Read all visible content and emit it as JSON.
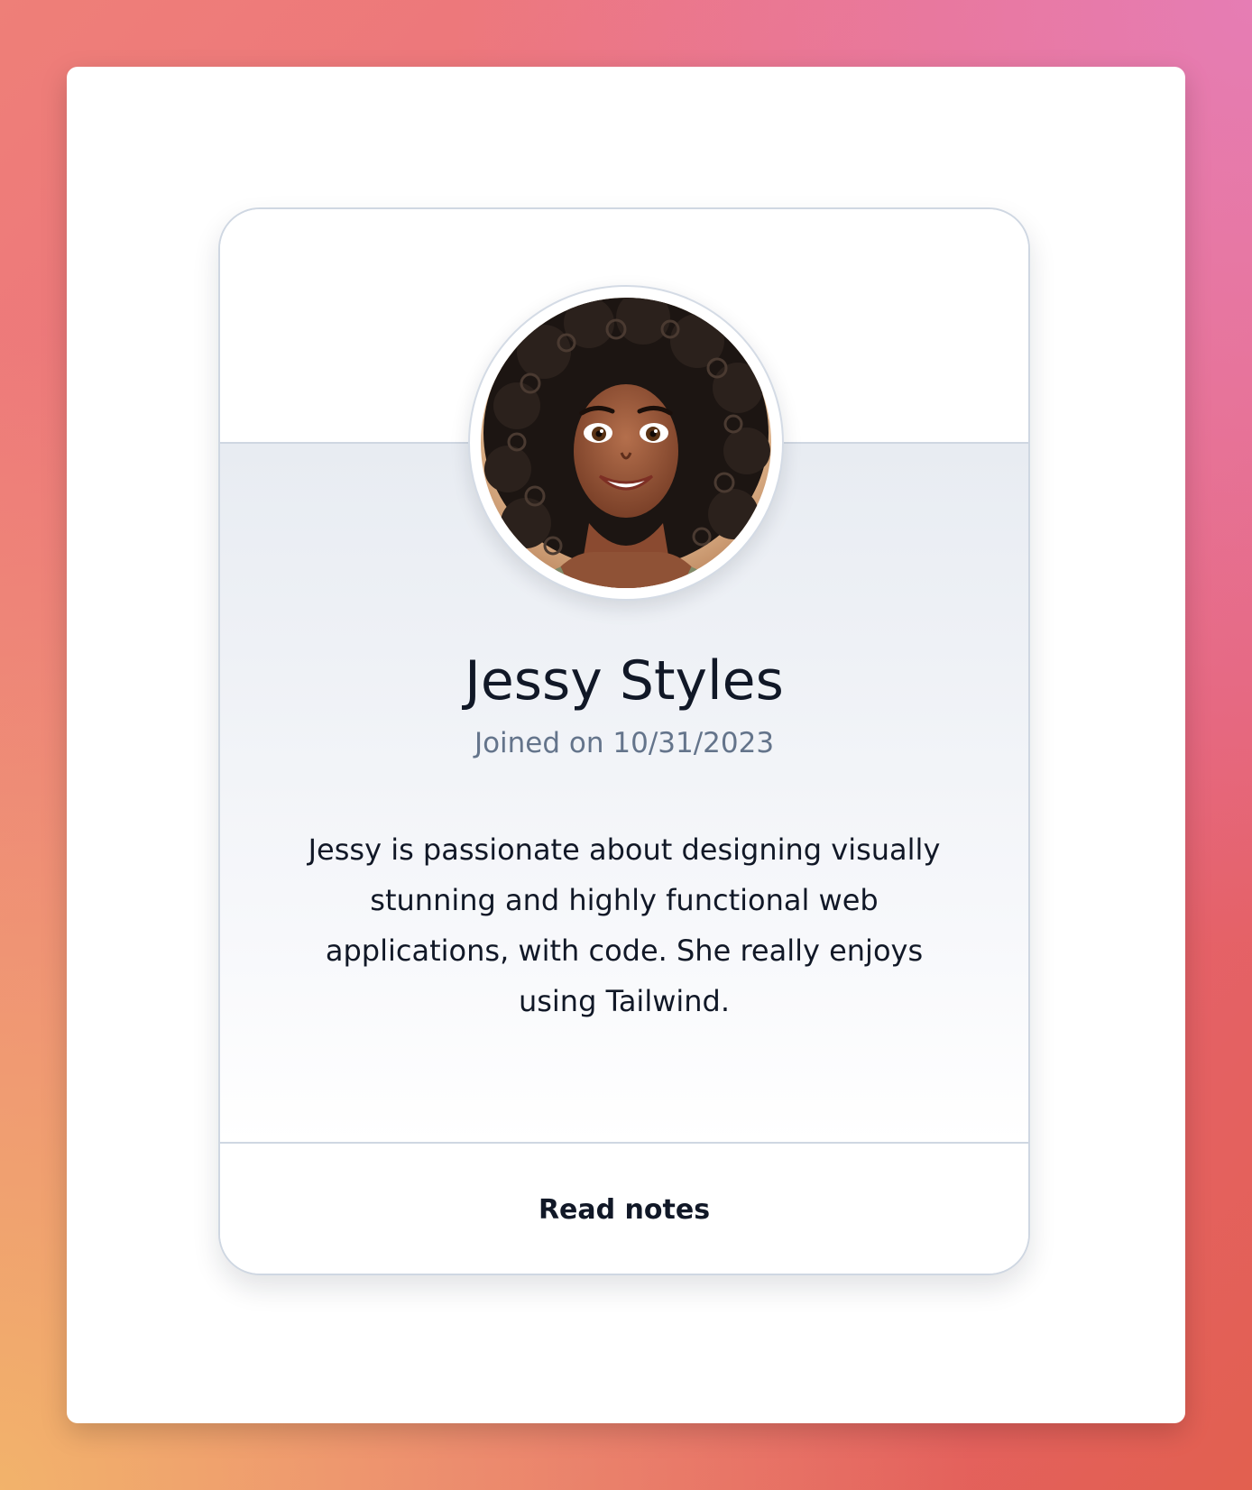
{
  "profile": {
    "name": "Jessy Styles",
    "joined": "Joined on 10/31/2023",
    "bio": "Jessy is passionate about designing visually stunning and highly functional web applications, with code. She really enjoys using Tailwind.",
    "avatar": "avatar-illustration"
  },
  "footer": {
    "action_label": "Read notes"
  },
  "colors": {
    "border": "#cfd7e2",
    "text_primary": "#111827",
    "text_muted": "#64748b",
    "body_tint": "#e8ecf2"
  }
}
